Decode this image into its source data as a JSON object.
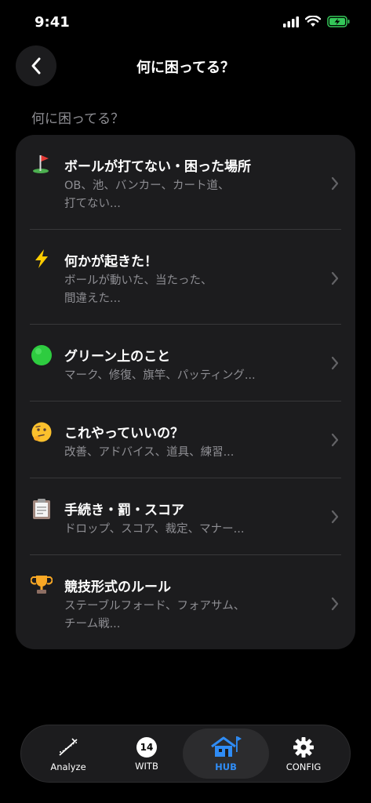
{
  "status_bar": {
    "time": "9:41"
  },
  "nav": {
    "title": "何に困ってる？"
  },
  "section": {
    "header": "何に困ってる？"
  },
  "items": [
    {
      "icon": "golf-flag-icon",
      "title": "ボールが打てない・困った場所",
      "subtitle_line1": "OB、池、バンカー、カート道、",
      "subtitle_line2": "打てない..."
    },
    {
      "icon": "lightning-icon",
      "title": "何かが起きた！",
      "subtitle_line1": "ボールが動いた、当たった、",
      "subtitle_line2": "間違えた..."
    },
    {
      "icon": "green-circle-icon",
      "title": "グリーン上のこと",
      "subtitle_line1": "マーク、修復、旗竿、パッティング...",
      "subtitle_line2": ""
    },
    {
      "icon": "thinking-face-icon",
      "title": "これやっていいの？",
      "subtitle_line1": "改善、アドバイス、道具、練習...",
      "subtitle_line2": ""
    },
    {
      "icon": "clipboard-icon",
      "title": "手続き・罰・スコア",
      "subtitle_line1": "ドロップ、スコア、裁定、マナー...",
      "subtitle_line2": ""
    },
    {
      "icon": "trophy-icon",
      "title": "競技形式のルール",
      "subtitle_line1": "ステーブルフォード、フォアサム、",
      "subtitle_line2": "チーム戦..."
    }
  ],
  "tabs": [
    {
      "label": "Analyze",
      "icon": "swing-path-icon"
    },
    {
      "label": "WITB",
      "icon": "club-count-badge-icon",
      "badge": "14"
    },
    {
      "label": "HUB",
      "icon": "clubhouse-icon",
      "active": true
    },
    {
      "label": "CONFIG",
      "icon": "gear-icon"
    }
  ],
  "colors": {
    "background": "#000000",
    "card": "#1c1c1e",
    "accent": "#2f8cf5",
    "secondary_text": "#8e8e93",
    "battery": "#34c759"
  }
}
